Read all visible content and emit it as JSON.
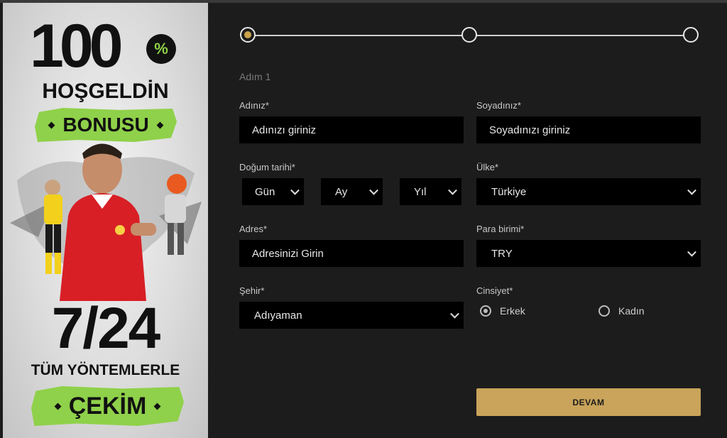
{
  "banner": {
    "big_number": "100",
    "percent": "%",
    "welcome": "HOŞGELDİN",
    "bonus": "BONUSU",
    "hours": "7/24",
    "methods": "TÜM YÖNTEMLERLE",
    "withdraw": "ÇEKİM",
    "accent_color": "#8fd14a"
  },
  "stepper": {
    "current_step": 1,
    "total_steps": 3,
    "active_color": "#c9a24a"
  },
  "step_title": "Adım 1",
  "form": {
    "first_name": {
      "label": "Adınız*",
      "placeholder": "Adınızı giriniz"
    },
    "last_name": {
      "label": "Soyadınız*",
      "placeholder": "Soyadınızı giriniz"
    },
    "birth_date": {
      "label": "Doğum tarihi*",
      "day": "Gün",
      "month": "Ay",
      "year": "Yıl"
    },
    "country": {
      "label": "Ülke*",
      "value": "Türkiye"
    },
    "address": {
      "label": "Adres*",
      "placeholder": "Adresinizi Girin"
    },
    "currency": {
      "label": "Para birimi*",
      "value": "TRY"
    },
    "city": {
      "label": "Şehir*",
      "value": "Adıyaman"
    },
    "gender": {
      "label": "Cinsiyet*",
      "male": "Erkek",
      "female": "Kadın",
      "selected": "male"
    }
  },
  "continue_label": "DEVAM",
  "button_color": "#c9a45a"
}
